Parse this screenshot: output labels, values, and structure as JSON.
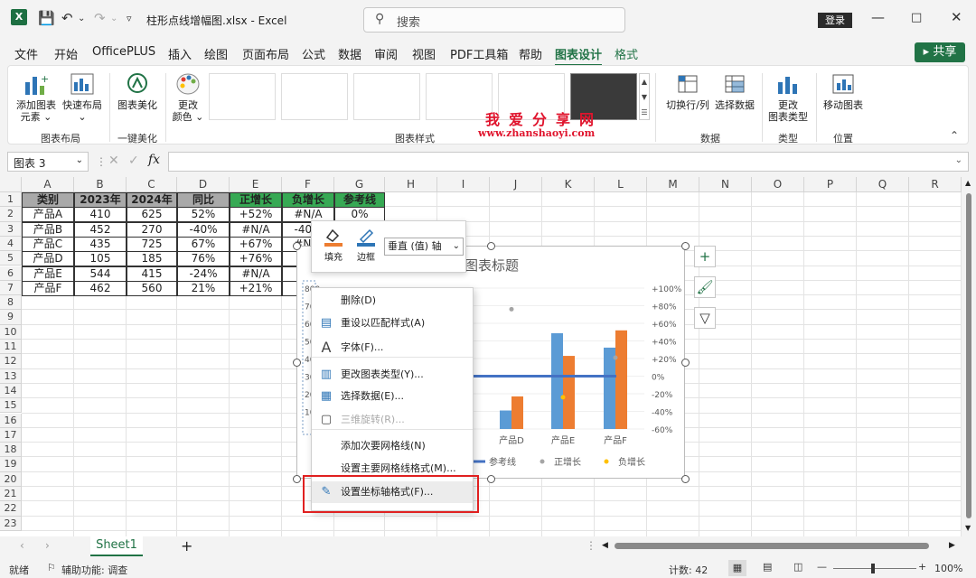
{
  "window": {
    "filename": "柱形点线增幅图.xlsx",
    "separator": "-",
    "app": "Excel",
    "search_placeholder": "搜索",
    "login_label": "登录"
  },
  "menu": {
    "tabs": [
      "文件",
      "开始",
      "OfficePLUS",
      "插入",
      "绘图",
      "页面布局",
      "公式",
      "数据",
      "审阅",
      "视图",
      "PDF工具箱",
      "帮助",
      "图表设计",
      "格式"
    ],
    "active_tab": "图表设计",
    "share_label": "共享"
  },
  "ribbon": {
    "add_chart_element": "添加图表",
    "add_chart_element_2": "元素",
    "quick_layout": "快速布局",
    "group_layout": "图表布局",
    "beautify": "图表美化",
    "group_beautify": "一键美化",
    "change_colors": "更改",
    "change_colors_2": "颜色",
    "group_styles": "图表样式",
    "switch_row_col": "切换行/列",
    "select_data": "选择数据",
    "group_data": "数据",
    "change_type": "更改",
    "change_type_2": "图表类型",
    "group_type": "类型",
    "move_chart": "移动图表",
    "group_location": "位置",
    "watermark_cn": "我爱分享网",
    "watermark_url": "www.zhanshaoyi.com"
  },
  "formula": {
    "name_box": "图表 3",
    "fx": "fx"
  },
  "grid": {
    "columns": [
      "A",
      "B",
      "C",
      "D",
      "E",
      "F",
      "G",
      "H",
      "I",
      "J",
      "K",
      "L",
      "M",
      "N",
      "O",
      "P",
      "Q",
      "R"
    ],
    "rows": [
      "1",
      "2",
      "3",
      "4",
      "5",
      "6",
      "7",
      "8",
      "9",
      "10",
      "11",
      "12",
      "13",
      "14",
      "15",
      "16",
      "17",
      "18",
      "19",
      "20",
      "21",
      "22",
      "23"
    ],
    "table_header": [
      "类别",
      "2023年",
      "2024年",
      "同比",
      "正增长",
      "负增长",
      "参考线"
    ],
    "table_rows": [
      [
        "产品A",
        "410",
        "625",
        "52%",
        "+52%",
        "#N/A",
        "0%"
      ],
      [
        "产品B",
        "452",
        "270",
        "-40%",
        "#N/A",
        "-40%",
        ""
      ],
      [
        "产品C",
        "435",
        "725",
        "67%",
        "+67%",
        "#N/A",
        ""
      ],
      [
        "产品D",
        "105",
        "185",
        "76%",
        "+76%",
        "",
        ""
      ],
      [
        "产品E",
        "544",
        "415",
        "-24%",
        "#N/A",
        "",
        ""
      ],
      [
        "产品F",
        "462",
        "560",
        "21%",
        "+21%",
        "",
        ""
      ]
    ]
  },
  "chart": {
    "title": "图表标题",
    "y_left_visible": [
      "800",
      "70",
      "60",
      "50",
      "40",
      "30",
      "20",
      "10"
    ],
    "y_right_ticks": [
      "+100%",
      "+80%",
      "+60%",
      "+40%",
      "+20%",
      "0%",
      "-20%",
      "-40%",
      "-60%"
    ],
    "x_visible": [
      "产品D",
      "产品E",
      "产品F"
    ],
    "legend": [
      "参考线",
      "正增长",
      "负增长"
    ],
    "colors": {
      "series2023": "#5b9bd5",
      "series2024": "#ed7d31",
      "reference": "#4472c4",
      "positive": "#a5a5a5",
      "negative": "#ffc000"
    }
  },
  "chart_data": {
    "type": "bar",
    "title": "图表标题",
    "categories": [
      "产品A",
      "产品B",
      "产品C",
      "产品D",
      "产品E",
      "产品F"
    ],
    "series": [
      {
        "name": "2023年",
        "values": [
          410,
          452,
          435,
          105,
          544,
          462
        ]
      },
      {
        "name": "2024年",
        "values": [
          625,
          270,
          725,
          185,
          415,
          560
        ]
      },
      {
        "name": "参考线",
        "values": [
          0,
          0,
          0,
          0,
          0,
          0
        ]
      },
      {
        "name": "正增长",
        "values": [
          0.52,
          null,
          0.67,
          0.76,
          null,
          0.21
        ]
      },
      {
        "name": "负增长",
        "values": [
          null,
          -0.4,
          null,
          null,
          -0.24,
          null
        ]
      }
    ],
    "ylim": [
      0,
      800
    ],
    "y2lim": [
      -0.6,
      1.0
    ],
    "legend": "bottom"
  },
  "minibar": {
    "fill": "填充",
    "border": "边框",
    "selector": "垂直 (值) 轴"
  },
  "context_menu": {
    "items": [
      {
        "label": "删除(D)",
        "icon": "delete-icon",
        "disabled": false
      },
      {
        "label": "重设以匹配样式(A)",
        "icon": "reset-style-icon",
        "disabled": false
      },
      {
        "label": "字体(F)...",
        "icon": "font-icon",
        "disabled": false
      },
      {
        "label": "更改图表类型(Y)...",
        "icon": "chart-type-icon",
        "disabled": false
      },
      {
        "label": "选择数据(E)...",
        "icon": "select-data-icon",
        "disabled": false
      },
      {
        "label": "三维旋转(R)...",
        "icon": "3d-rotate-icon",
        "disabled": true
      },
      {
        "label": "添加次要网格线(N)",
        "icon": "",
        "disabled": false
      },
      {
        "label": "设置主要网格线格式(M)...",
        "icon": "",
        "disabled": false
      },
      {
        "label": "设置坐标轴格式(F)...",
        "icon": "format-axis-icon",
        "disabled": false
      }
    ]
  },
  "sheets": {
    "active": "Sheet1",
    "add": "+"
  },
  "status": {
    "ready": "就绪",
    "accessibility": "辅助功能: 调查",
    "count": "计数: 42",
    "zoom": "100%"
  }
}
